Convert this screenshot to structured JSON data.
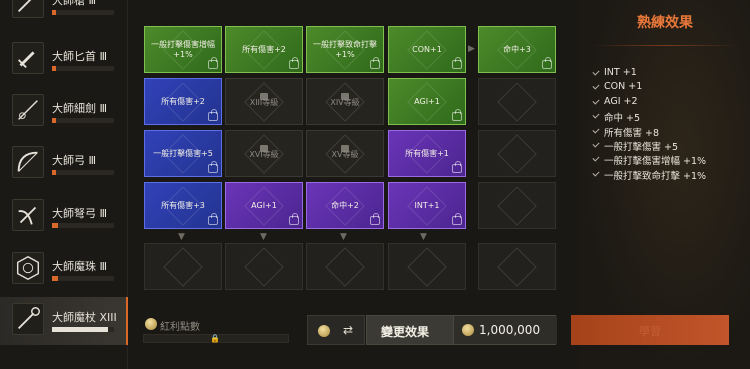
{
  "sidebar": {
    "weapons": [
      {
        "name": "大師槍 Ⅲ",
        "progress": 0.06,
        "icon": "spear-icon"
      },
      {
        "name": "大師匕首 Ⅲ",
        "progress": 0.06,
        "icon": "dagger-icon"
      },
      {
        "name": "大師細劍 Ⅲ",
        "progress": 0.06,
        "icon": "rapier-icon"
      },
      {
        "name": "大師弓 Ⅲ",
        "progress": 0.06,
        "icon": "bow-icon"
      },
      {
        "name": "大師弩弓 Ⅲ",
        "progress": 0.1,
        "icon": "crossbow-icon"
      },
      {
        "name": "大師魔珠 Ⅲ",
        "progress": 0.1,
        "icon": "orb-icon"
      },
      {
        "name": "大師魔杖 XIII",
        "progress": 0.9,
        "icon": "staff-icon",
        "active": true
      }
    ]
  },
  "grid": {
    "rows": [
      [
        {
          "label": "一般打擊傷害增幅\n+1%",
          "state": "green"
        },
        {
          "label": "所有傷害+2",
          "state": "green"
        },
        {
          "label": "一般打擊致命打擊\n+1%",
          "state": "green"
        },
        {
          "label": "CON+1",
          "state": "green"
        },
        {
          "label": "命中+3",
          "state": "green"
        }
      ],
      [
        {
          "label": "所有傷害+2",
          "state": "blue"
        },
        {
          "label": "XIII等級",
          "state": "locked"
        },
        {
          "label": "XIV等級",
          "state": "locked"
        },
        {
          "label": "AGI+1",
          "state": "green"
        },
        {
          "label": "",
          "state": "empty"
        }
      ],
      [
        {
          "label": "一般打擊傷害+5",
          "state": "blue"
        },
        {
          "label": "XVI等級",
          "state": "locked"
        },
        {
          "label": "XV等級",
          "state": "locked"
        },
        {
          "label": "所有傷害+1",
          "state": "purple"
        },
        {
          "label": "",
          "state": "empty"
        }
      ],
      [
        {
          "label": "所有傷害+3",
          "state": "blue"
        },
        {
          "label": "AGI+1",
          "state": "purple"
        },
        {
          "label": "命中+2",
          "state": "purple"
        },
        {
          "label": "INT+1",
          "state": "purple"
        },
        {
          "label": "",
          "state": "empty"
        }
      ],
      [
        {
          "label": "",
          "state": "empty"
        },
        {
          "label": "",
          "state": "empty"
        },
        {
          "label": "",
          "state": "empty"
        },
        {
          "label": "",
          "state": "empty"
        },
        {
          "label": "",
          "state": "empty"
        }
      ]
    ]
  },
  "bottom": {
    "bonus_label": "紅利點數",
    "change_label": "變更效果",
    "change_cost": "1,000,000",
    "swap_symbol": "⇄",
    "confirm_label": "學習"
  },
  "panel": {
    "title": "熟練效果",
    "effects": [
      "INT +1",
      "CON +1",
      "AGI +2",
      "命中 +5",
      "所有傷害 +8",
      "一般打擊傷害 +5",
      "一般打擊傷害增幅 +1%",
      "一般打擊致命打擊 +1%"
    ]
  },
  "colors": {
    "accent": "#d8692a",
    "green_cell": "#4d8a2a",
    "blue_cell": "#3142b8",
    "purple_cell": "#6a35b8"
  }
}
